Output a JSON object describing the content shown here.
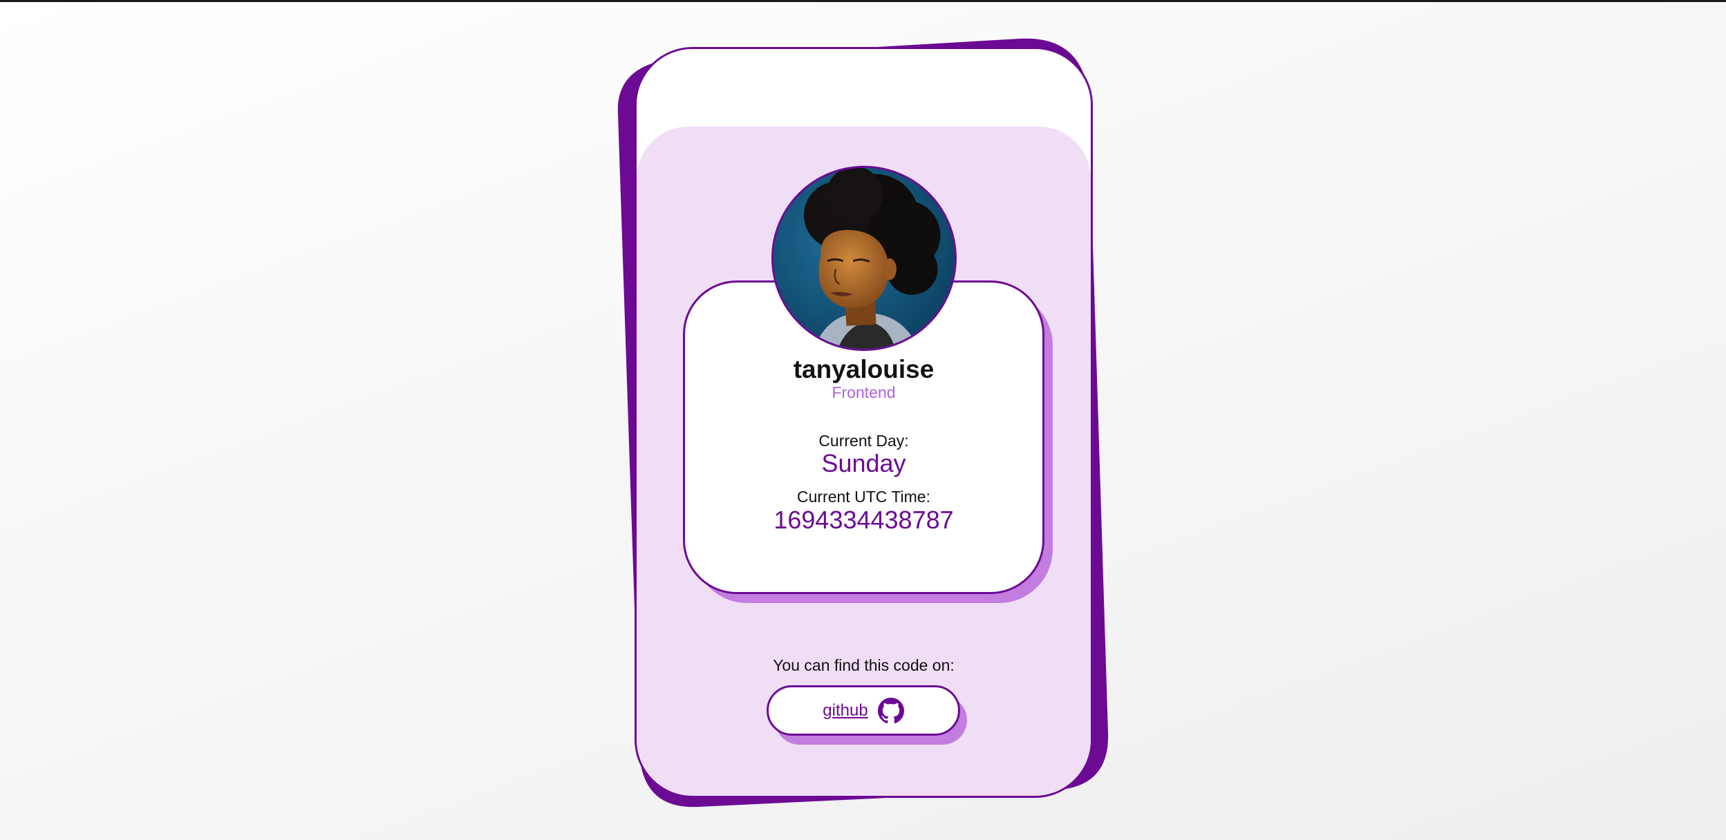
{
  "theme": {
    "accent": "#6c0a94",
    "accent_light": "#c27ddf",
    "panel_bg": "#f0def6",
    "role_color": "#b15fd6"
  },
  "profile": {
    "username": "tanyalouise",
    "role": "Frontend",
    "avatar_icon": "profile-photo"
  },
  "status": {
    "day_label": "Current Day:",
    "day_value": "Sunday",
    "time_label": "Current UTC Time:",
    "time_value": "1694334438787"
  },
  "footer": {
    "find_text": "You can find this code on:",
    "github_label": "github",
    "github_icon": "github-icon"
  }
}
